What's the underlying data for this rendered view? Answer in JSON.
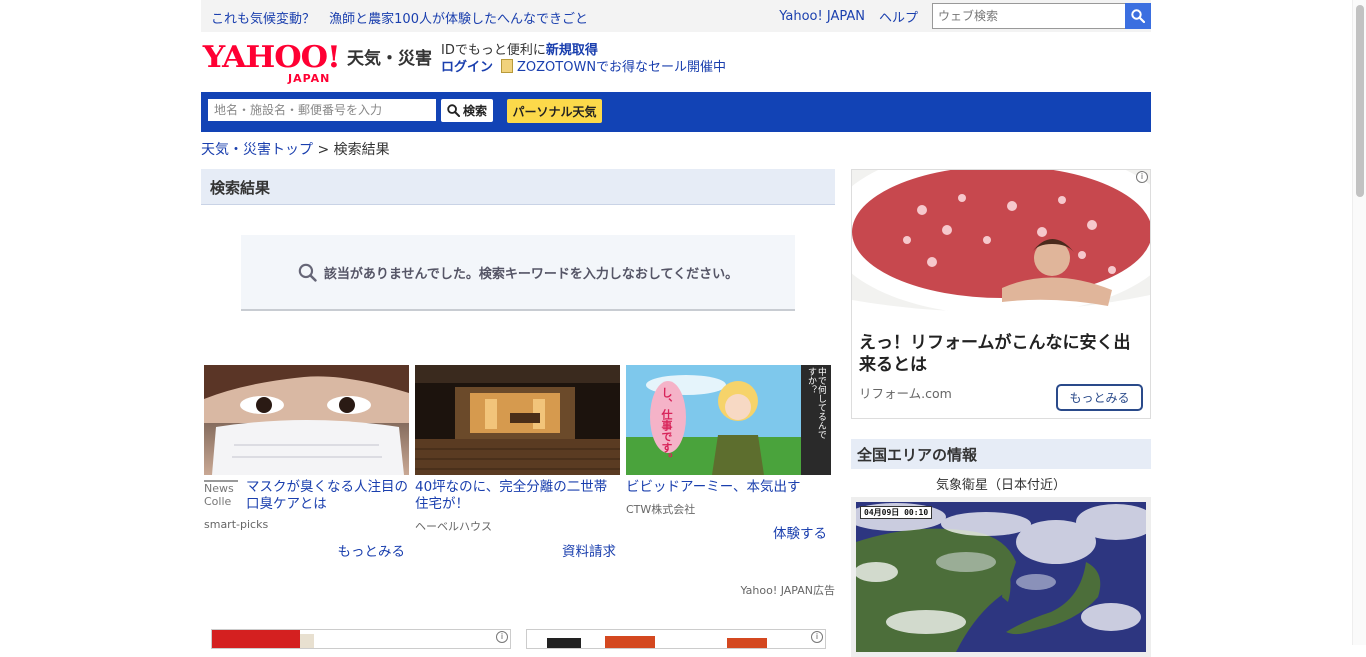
{
  "topbar": {
    "promo1": "これも気候変動？",
    "promo2": "漁師と農家100人が体験したへんなできごと",
    "yahoo_link": "Yahoo! JAPAN",
    "help_link": "ヘルプ",
    "web_search_placeholder": "ウェブ検索"
  },
  "header": {
    "logo_text": "YAHOO!",
    "logo_sub": "JAPAN",
    "service_name": "天気・災害",
    "id_text": "IDでもっと便利に",
    "signup_link": "新規取得",
    "login_link": "ログイン",
    "zozo_text": "ZOZOTOWNでお得なセール開催中"
  },
  "searchbar": {
    "placeholder": "地名・施設名・郵便番号を入力",
    "search_button": "検索",
    "personal_button": "パーソナル天気"
  },
  "breadcrumb": {
    "home": "天気・災害トップ",
    "separator": ">",
    "current": "検索結果"
  },
  "main": {
    "heading": "検索結果",
    "no_result": "該当がありませんでした。検索キーワードを入力しなおしてください。",
    "ads": [
      {
        "badge": "News Colle",
        "title": "マスクが臭くなる人注目の口臭ケアとは",
        "source": "smart-picks",
        "action": "もっとみる"
      },
      {
        "title": "40坪なのに、完全分離の二世帯住宅が！",
        "source": "ヘーベルハウス",
        "action": "資料請求"
      },
      {
        "title": "ビビッドアーミー、本気出す",
        "source": "CTW株式会社",
        "action": "体験する",
        "img_text": "し、仕事です。",
        "img_side": "中で何してるんですか？"
      }
    ],
    "ad_label": "Yahoo! JAPAN広告"
  },
  "sidebar": {
    "ad": {
      "title": "えっ！リフォームがこんなに安く出来るとは",
      "source": "リフォーム.com",
      "action": "もっとみる"
    },
    "area_heading": "全国エリアの情報",
    "satellite_label": "気象衛星（日本付近）",
    "satellite_time": "04月09日 00:10"
  },
  "colors": {
    "brand_red": "#ff0033",
    "nav_blue": "#1243b5",
    "link_blue": "#1a3fae",
    "personal_yellow": "#fcd94a"
  }
}
